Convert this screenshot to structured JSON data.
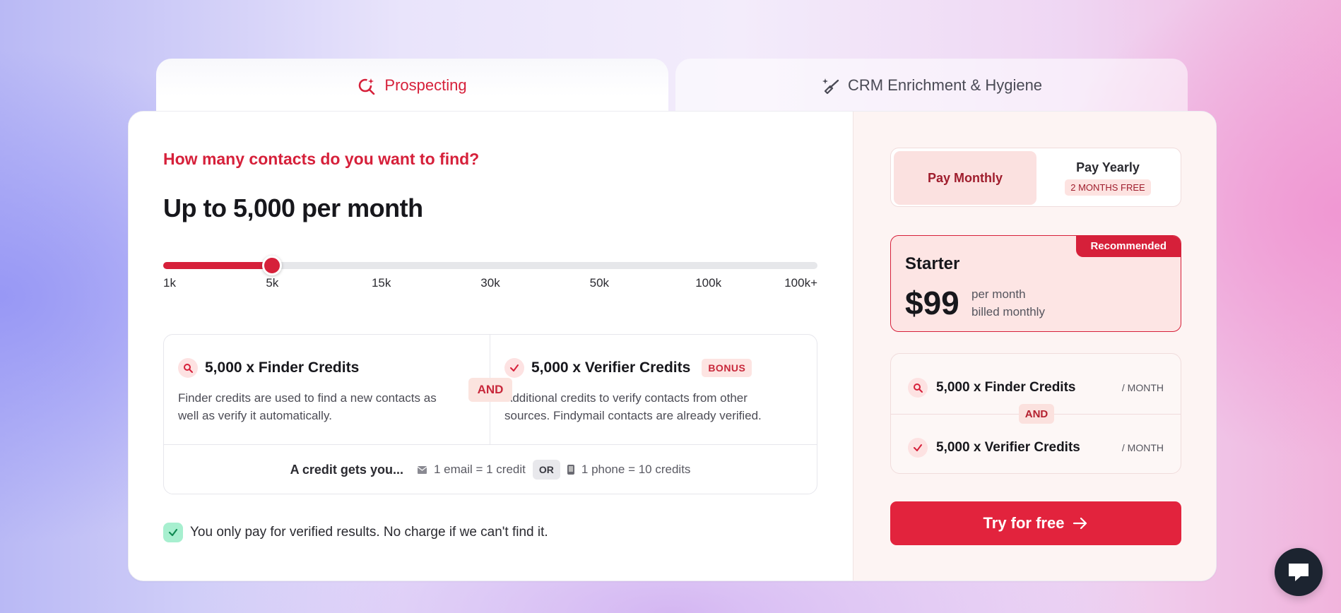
{
  "tabs": [
    {
      "label": "Prospecting",
      "icon": "search-sparkle-icon",
      "active": true
    },
    {
      "label": "CRM Enrichment & Hygiene",
      "icon": "broom-sparkle-icon",
      "active": false
    }
  ],
  "selector": {
    "question": "How many contacts do you want to find?",
    "headline": "Up to 5,000 per month",
    "slider": {
      "ticks": [
        "1k",
        "5k",
        "15k",
        "30k",
        "50k",
        "100k",
        "100k+"
      ],
      "selected": "5k",
      "selected_index": 1
    }
  },
  "credits": {
    "finder": {
      "title": "5,000 x Finder Credits",
      "desc": "Finder credits are used to find a new contacts as well as verify it automatically.",
      "icon": "search-icon"
    },
    "and_label": "AND",
    "verifier": {
      "title": "5,000 x Verifier Credits",
      "badge": "BONUS",
      "desc": "Additional credits to verify contacts from other sources. Findymail contacts are already verified.",
      "icon": "check-icon"
    },
    "footer": {
      "lead": "A credit gets you...",
      "email": "1 email = 1 credit",
      "or": "OR",
      "phone": "1 phone = 10 credits"
    }
  },
  "guarantee": "You only pay for verified results. No charge if we can't find it.",
  "billing": {
    "monthly": "Pay Monthly",
    "yearly": "Pay Yearly",
    "yearly_tag": "2 MONTHS FREE",
    "selected": "monthly"
  },
  "plan": {
    "badge": "Recommended",
    "name": "Starter",
    "price": "$99",
    "per": "per month",
    "billed": "billed monthly"
  },
  "summary": {
    "finder": "5,000 x Finder Credits",
    "verifier": "5,000 x Verifier Credits",
    "unit": "/ MONTH",
    "and": "AND"
  },
  "cta": {
    "label": "Try for free"
  },
  "colors": {
    "accent": "#d6203a",
    "accent_soft": "#fde5e4",
    "success": "#a7efcf",
    "chat": "#1c2430"
  }
}
